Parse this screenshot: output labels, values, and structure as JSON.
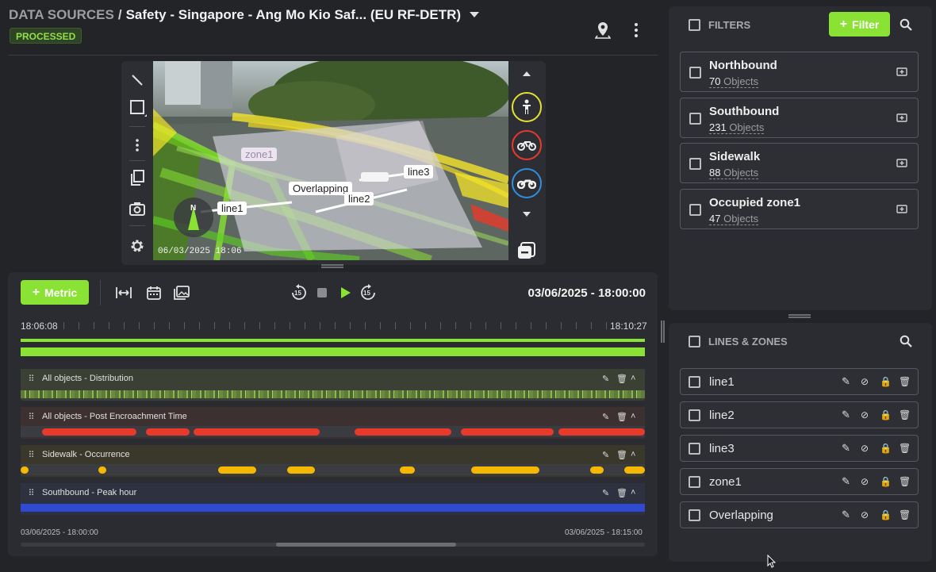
{
  "header": {
    "breadcrumb_root": "DATA SOURCES",
    "separator": "/",
    "title": "Safety - Singapore - Ang Mo Kio Saf... (EU RF-DETR)",
    "status_badge": "PROCESSED"
  },
  "video": {
    "timestamp": "06/03/2025 18:06",
    "compass_label": "N",
    "overlay_labels": {
      "zone1": "zone1",
      "line1": "line1",
      "line2": "line2",
      "line3": "line3",
      "overlapping": "Overlapping"
    }
  },
  "toolbar": {
    "metric_label": "Metric",
    "datetime": "03/06/2025 - 18:00:00",
    "rewind_label": "15",
    "forward_label": "15"
  },
  "timeline": {
    "start_time": "18:06:08",
    "end_time": "18:10:27",
    "range_start": "03/06/2025 - 18:00:00",
    "range_end": "03/06/2025 - 18:15:00",
    "tracks": [
      {
        "name": "All objects - Distribution",
        "color": "#8ae234"
      },
      {
        "name": "All objects - Post Encroachment Time",
        "color": "#e8392b"
      },
      {
        "name": "Sidewalk - Occurrence",
        "color": "#f5b800"
      },
      {
        "name": "Southbound - Peak hour",
        "color": "#2f4ad0"
      }
    ]
  },
  "filters": {
    "title": "FILTERS",
    "add_label": "Filter",
    "items": [
      {
        "name": "Northbound",
        "count": "70",
        "unit": "Objects"
      },
      {
        "name": "Southbound",
        "count": "231",
        "unit": "Objects"
      },
      {
        "name": "Sidewalk",
        "count": "88",
        "unit": "Objects"
      },
      {
        "name": "Occupied zone1",
        "count": "47",
        "unit": "Objects"
      }
    ]
  },
  "lines_zones": {
    "title": "LINES & ZONES",
    "items": [
      "line1",
      "line2",
      "line3",
      "zone1",
      "Overlapping"
    ]
  },
  "colors": {
    "accent": "#8ae234",
    "pet": "#e8392b",
    "occurrence": "#f5b800",
    "peak": "#2f4ad0"
  }
}
